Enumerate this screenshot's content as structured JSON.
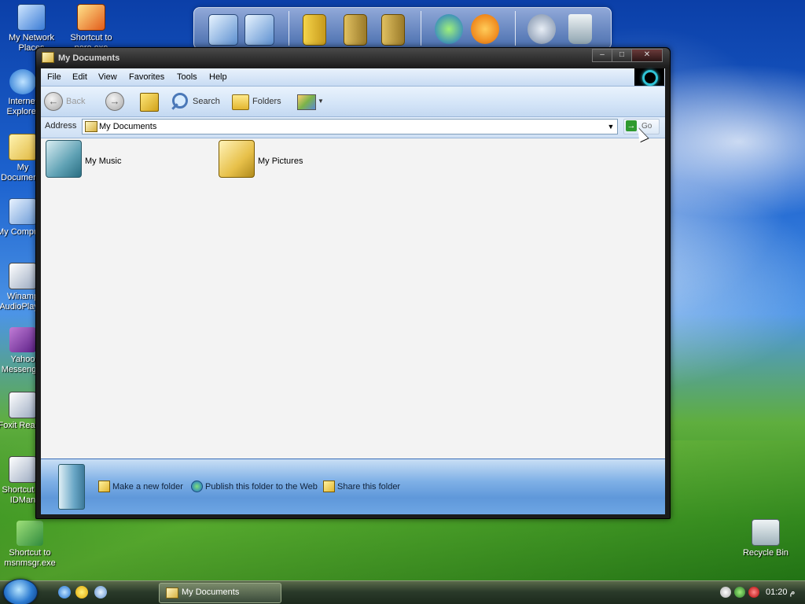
{
  "desktop": {
    "icons": [
      {
        "label": "My Network Places"
      },
      {
        "label": "Shortcut to nero.exe"
      },
      {
        "label": "Internet Explorer"
      },
      {
        "label": "My Documents"
      },
      {
        "label": "My Computer"
      },
      {
        "label": "Winamp AudioPlayer"
      },
      {
        "label": "Yahoo Messenger"
      },
      {
        "label": "Foxit Reader"
      },
      {
        "label": "Shortcut to IDMan"
      },
      {
        "label": "Shortcut to msnmsgr.exe"
      },
      {
        "label": "Recycle Bin"
      }
    ]
  },
  "window": {
    "title": "My Documents",
    "controls": {
      "minimize": "–",
      "maximize": "□",
      "close": "✕"
    },
    "menu": [
      "File",
      "Edit",
      "View",
      "Favorites",
      "Tools",
      "Help"
    ],
    "toolbar": {
      "back": "Back",
      "search": "Search",
      "folders": "Folders"
    },
    "address": {
      "label": "Address",
      "value": "My Documents",
      "go": "Go"
    },
    "items": [
      {
        "label": "My Music",
        "icon": "music-folder-icon"
      },
      {
        "label": "My Pictures",
        "icon": "pictures-folder-icon"
      }
    ],
    "tasks": [
      {
        "label": "Make a new folder"
      },
      {
        "label": "Publish this folder to the Web"
      },
      {
        "label": "Share this folder"
      }
    ]
  },
  "taskbar": {
    "task_label": "My Documents",
    "clock": "01:20 م"
  }
}
